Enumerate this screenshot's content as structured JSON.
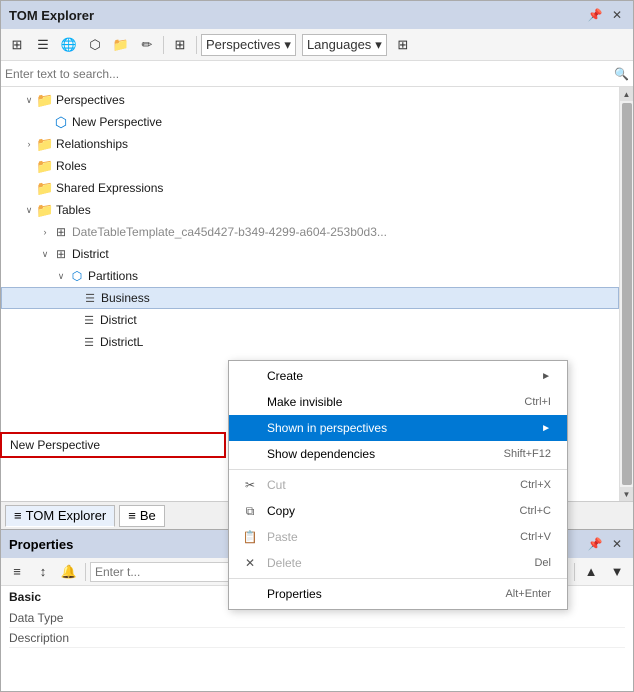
{
  "tomExplorer": {
    "title": "TOM Explorer",
    "toolbar": {
      "buttons": [
        "⊞",
        "☰",
        "🌲",
        "⬡",
        "📁",
        "✏",
        "⊞"
      ],
      "dropdown1": "Perspectives",
      "dropdown2": "Languages"
    },
    "search": {
      "placeholder": "Enter text to search...",
      "icon": "🔍"
    },
    "tree": {
      "items": [
        {
          "indent": 1,
          "expand": "∨",
          "icon": "folder",
          "label": "Perspectives",
          "gray": false
        },
        {
          "indent": 2,
          "expand": "",
          "icon": "perspective",
          "label": "New Perspective",
          "gray": false
        },
        {
          "indent": 1,
          "expand": "›",
          "icon": "folder",
          "label": "Relationships",
          "gray": false
        },
        {
          "indent": 1,
          "expand": "",
          "icon": "folder",
          "label": "Roles",
          "gray": false
        },
        {
          "indent": 1,
          "expand": "",
          "icon": "folder",
          "label": "Shared Expressions",
          "gray": false
        },
        {
          "indent": 1,
          "expand": "∨",
          "icon": "folder",
          "label": "Tables",
          "gray": false
        },
        {
          "indent": 2,
          "expand": "›",
          "icon": "table",
          "label": "DateTableTemplate_ca45d427-b349-4299-a604-253b0d3...",
          "gray": true
        },
        {
          "indent": 2,
          "expand": "∨",
          "icon": "table",
          "label": "District",
          "gray": false
        },
        {
          "indent": 3,
          "expand": "∨",
          "icon": "partition",
          "label": "Partitions",
          "gray": false
        },
        {
          "indent": 4,
          "expand": "",
          "icon": "measure",
          "label": "Business",
          "gray": false
        },
        {
          "indent": 4,
          "expand": "",
          "icon": "measure",
          "label": "District",
          "gray": false
        },
        {
          "indent": 4,
          "expand": "",
          "icon": "measure",
          "label": "DistrictL",
          "gray": false
        }
      ]
    },
    "tabs": [
      {
        "label": "TOM Explorer",
        "icon": "≡"
      },
      {
        "label": "Be",
        "icon": "≡"
      }
    ]
  },
  "contextMenu": {
    "items": [
      {
        "icon": "",
        "label": "Create",
        "shortcut": "",
        "arrow": "►",
        "disabled": false,
        "highlighted": false
      },
      {
        "icon": "",
        "label": "Make invisible",
        "shortcut": "Ctrl+I",
        "arrow": "",
        "disabled": false,
        "highlighted": false
      },
      {
        "icon": "",
        "label": "Shown in perspectives",
        "shortcut": "",
        "arrow": "►",
        "disabled": false,
        "highlighted": true
      },
      {
        "icon": "",
        "label": "Show dependencies",
        "shortcut": "Shift+F12",
        "arrow": "",
        "disabled": false,
        "highlighted": false
      },
      {
        "separator": true
      },
      {
        "icon": "✂",
        "label": "Cut",
        "shortcut": "Ctrl+X",
        "arrow": "",
        "disabled": true,
        "highlighted": false
      },
      {
        "icon": "📋",
        "label": "Copy",
        "shortcut": "Ctrl+C",
        "arrow": "",
        "disabled": false,
        "highlighted": false
      },
      {
        "icon": "📄",
        "label": "Paste",
        "shortcut": "Ctrl+V",
        "arrow": "",
        "disabled": true,
        "highlighted": false
      },
      {
        "icon": "✕",
        "label": "Delete",
        "shortcut": "Del",
        "arrow": "",
        "disabled": true,
        "highlighted": false
      },
      {
        "separator": true
      },
      {
        "icon": "",
        "label": "Properties",
        "shortcut": "Alt+Enter",
        "arrow": "",
        "disabled": false,
        "highlighted": false
      }
    ]
  },
  "newPerspectiveHighlight": {
    "label": "New Perspective"
  },
  "properties": {
    "title": "Properties",
    "toolbar": {
      "btns": [
        "≡",
        "↕",
        "🔔"
      ]
    },
    "search_placeholder": "Enter t...",
    "section": "Basic",
    "fields": [
      {
        "key": "Data Type",
        "value": ""
      },
      {
        "key": "Description",
        "value": ""
      }
    ]
  }
}
